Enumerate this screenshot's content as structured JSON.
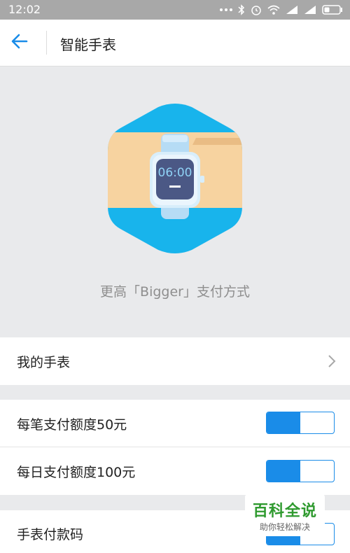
{
  "status_bar": {
    "time": "12:02",
    "icons": [
      "more-dots-icon",
      "bluetooth-icon",
      "alarm-icon",
      "wifi-icon",
      "signal-icon",
      "signal-icon",
      "battery-icon"
    ]
  },
  "app_bar": {
    "back_icon": "back-arrow-icon",
    "title": "智能手表"
  },
  "hero": {
    "watch_time": "06:00",
    "caption": "更高「Bigger」支付方式",
    "colors": {
      "hex_blue": "#18b4ec",
      "band": "#f7d3a0",
      "watch_face": "#4b5885",
      "strap": "#b6dcf5"
    }
  },
  "rows": {
    "my_watch": {
      "label": "我的手表",
      "icon": "chevron-right-icon"
    },
    "per_payment_limit": {
      "label": "每笔支付额度50元",
      "on": true
    },
    "daily_limit": {
      "label": "每日支付额度100元",
      "on": true
    },
    "payment_code": {
      "label": "手表付款码",
      "on": true
    }
  },
  "watermark": {
    "title": "百科全说",
    "subtitle": "助你轻松解决"
  },
  "colors": {
    "accent": "#1a8ce8"
  }
}
